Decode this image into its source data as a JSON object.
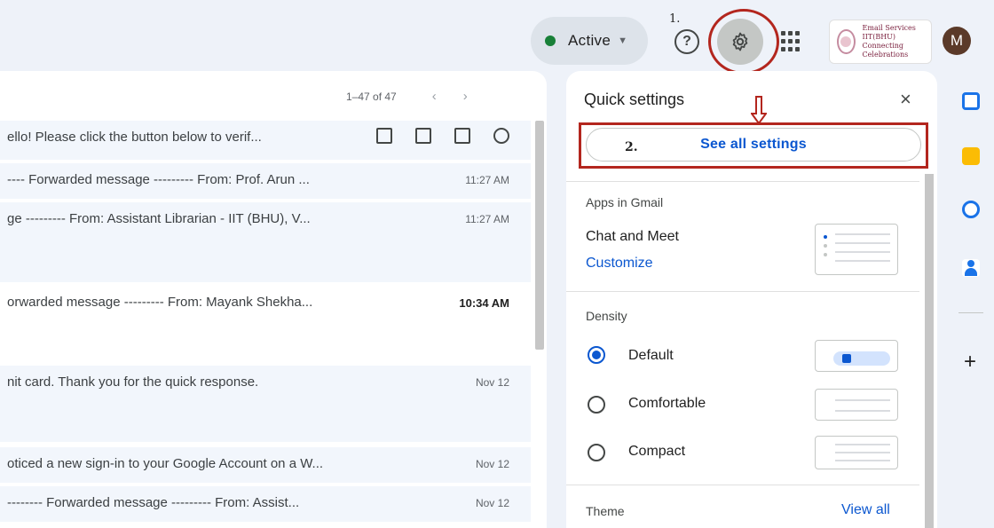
{
  "header": {
    "status_label": "Active",
    "step1_label": "1.",
    "avatar_initial": "M",
    "brand": {
      "line1": "Email Services",
      "line2": "IIT(BHU)",
      "line3": "Connecting Celebrations"
    }
  },
  "mail": {
    "pager_range": "1–47 of 47",
    "prev": "‹",
    "next": "›",
    "rows": [
      {
        "snippet": "ello! Please click the button below to verif...",
        "time": ""
      },
      {
        "snippet": "---- Forwarded message --------- From: Prof. Arun ...",
        "time": "11:27 AM"
      },
      {
        "snippet": "ge --------- From: Assistant Librarian - IIT (BHU), V...",
        "time": "11:27 AM"
      },
      {
        "snippet": "orwarded message --------- From: Mayank Shekha...",
        "time": "10:34 AM"
      },
      {
        "snippet": "nit card. Thank you for the quick response.",
        "time": "Nov 12"
      },
      {
        "snippet": "oticed a new sign-in to your Google Account on a W...",
        "time": "Nov 12"
      },
      {
        "snippet": "-------- Forwarded message --------- From: Assist...",
        "time": "Nov 12"
      }
    ]
  },
  "quick_settings": {
    "title": "Quick settings",
    "close": "×",
    "step2_label": "2.",
    "see_all_label": "See all settings",
    "apps_section": "Apps in Gmail",
    "chat_meet": "Chat and Meet",
    "customize": "Customize",
    "density_section": "Density",
    "density_options": [
      "Default",
      "Comfortable",
      "Compact"
    ],
    "theme_section": "Theme",
    "view_all": "View all"
  },
  "colors": {
    "accent_blue": "#0b57d0",
    "annotation_red": "#b3261e",
    "active_green": "#188038"
  },
  "icons": {
    "help": "help-circle-icon",
    "settings": "gear-icon",
    "apps": "apps-grid-icon",
    "archive": "archive-icon",
    "delete": "trash-icon",
    "mark_read": "mail-open-icon",
    "snooze": "clock-icon"
  }
}
